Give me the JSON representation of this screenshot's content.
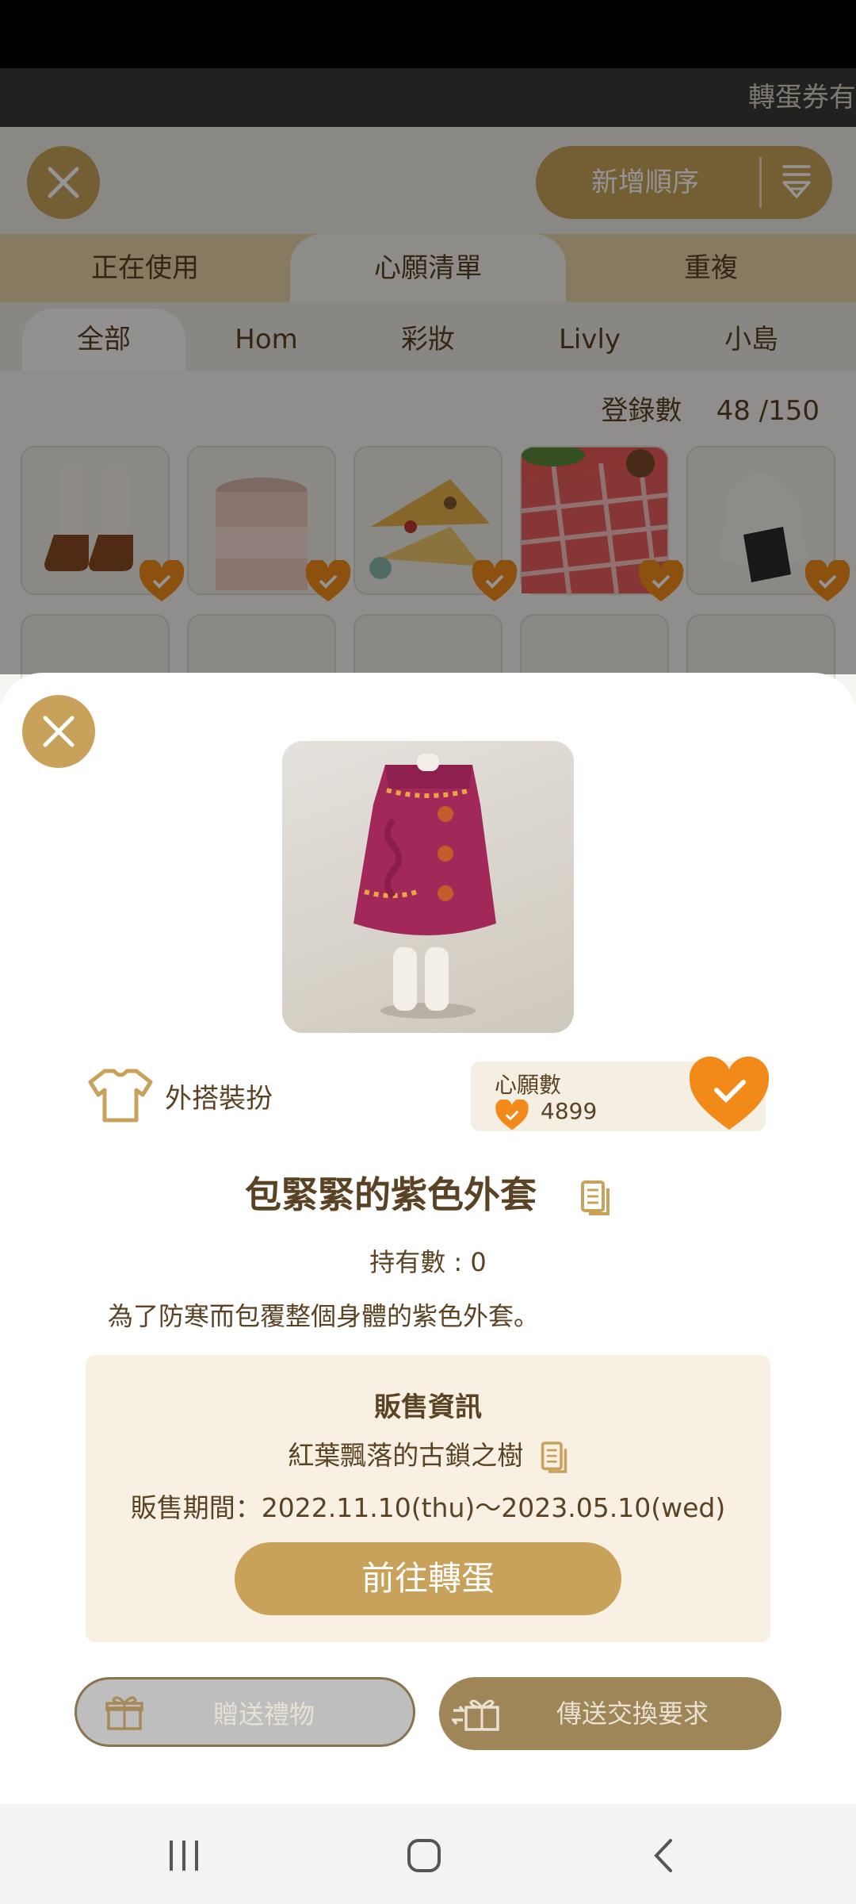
{
  "marquee": {
    "text": "轉蛋券有"
  },
  "header": {
    "close_icon": "close-icon",
    "sort_label": "新增順序",
    "sort_icon": "sort-icon"
  },
  "tabs_primary": [
    {
      "label": "正在使用"
    },
    {
      "label": "心願清單"
    },
    {
      "label": "重複"
    }
  ],
  "tabs_secondary": [
    {
      "label": "全部"
    },
    {
      "label": "Hom"
    },
    {
      "label": "彩妝"
    },
    {
      "label": "Livly"
    },
    {
      "label": "小島"
    }
  ],
  "registration": {
    "label": "登錄數",
    "count": "48 /150"
  },
  "grid": {
    "items": [
      "boots",
      "jar",
      "pizza",
      "picnic-blanket",
      "rice-ball"
    ],
    "check_icon": "heart-check-icon"
  },
  "detail": {
    "category_label": "外搭裝扮",
    "category_icon": "shirt-icon",
    "wish_label": "心願數",
    "wish_count": "4899",
    "item_title": "包緊緊的紫色外套",
    "held_label": "持有數 : 0",
    "description": "為了防寒而包覆整個身體的紫色外套。",
    "sale_header": "販售資訊",
    "sale_location": "紅葉飄落的古鎖之樹",
    "sale_period": "販售期間：2022.11.10(thu)～2023.05.10(wed)",
    "go_button": "前往轉蛋",
    "gift_button": "贈送禮物",
    "trade_button": "傳送交換要求"
  },
  "colors": {
    "accent": "#c8a25b",
    "heart": "#f28a1a",
    "text": "#5a4324"
  }
}
